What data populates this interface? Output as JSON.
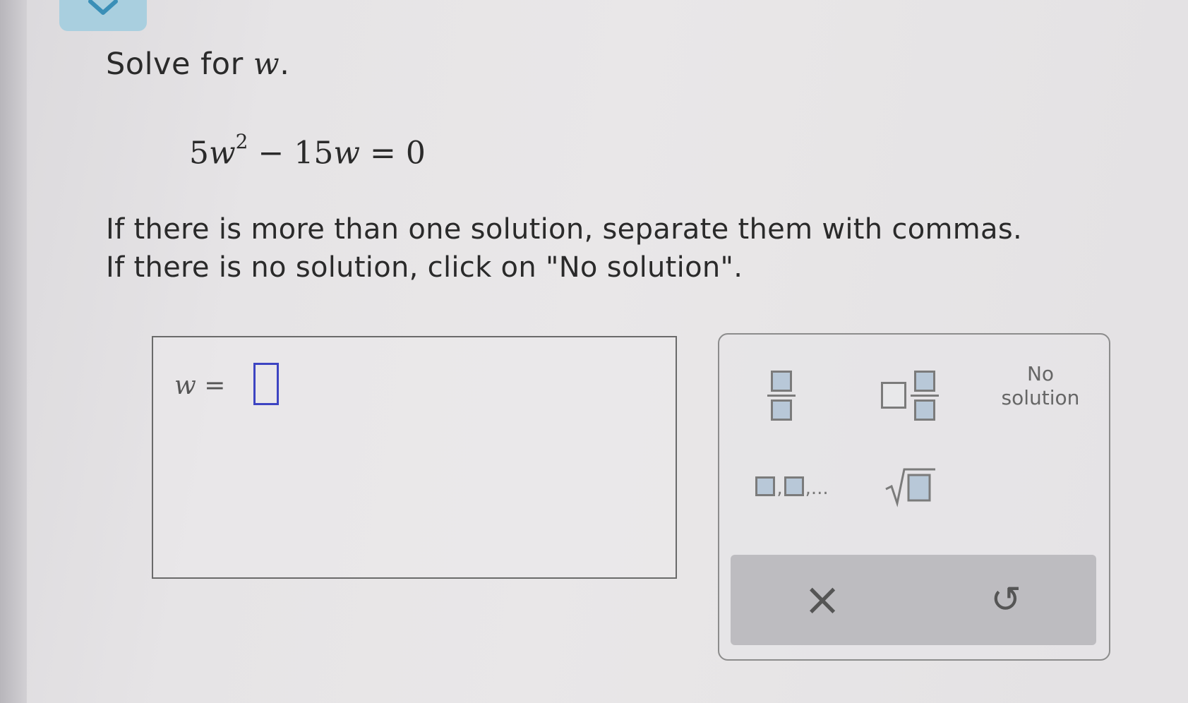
{
  "problem": {
    "prompt_text": "Solve for ",
    "prompt_var": "w",
    "prompt_end": ".",
    "equation": {
      "coef1": "5",
      "var": "w",
      "exp": "2",
      "minus": " − 15",
      "var2": "w",
      "rhs": " = 0"
    },
    "instruction_line1": "If there is more than one solution, separate them with commas.",
    "instruction_line2": "If there is no solution, click on \"No solution\"."
  },
  "answer": {
    "var": "w",
    "equals": " =",
    "value": ""
  },
  "keypad": {
    "no_solution_line1": "No",
    "no_solution_line2": "solution",
    "list_ellipsis": ",...",
    "clear_symbol": "×",
    "undo_symbol": "↺"
  },
  "colors": {
    "input_border": "#3d44c2",
    "tab_accent": "#a9cfdf",
    "key_box_fill": "#b8c8d8"
  },
  "icons": [
    "chevron-down-icon",
    "fraction-icon",
    "mixed-number-icon",
    "list-icon",
    "sqrt-icon",
    "clear-icon",
    "undo-icon"
  ]
}
